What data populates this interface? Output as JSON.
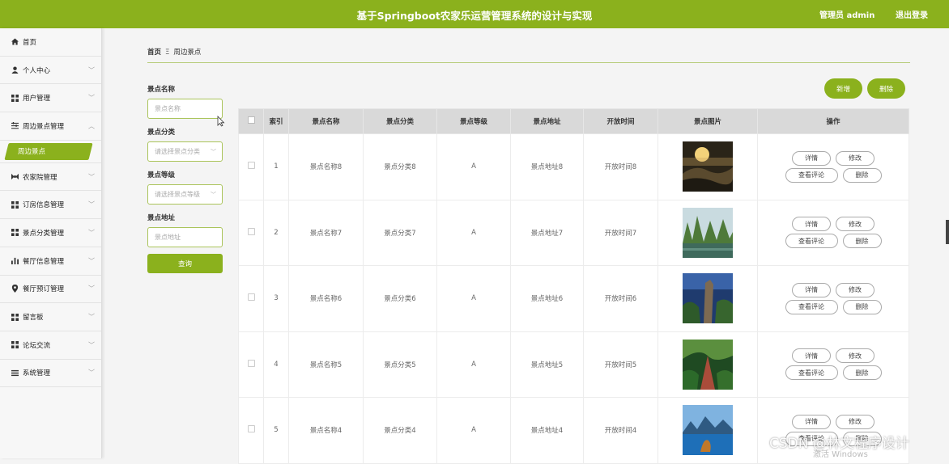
{
  "header": {
    "title": "基于Springboot农家乐运营管理系统的设计与实现",
    "admin": "管理员 admin",
    "logout": "退出登录",
    "bg_color": "#8bb11d"
  },
  "sidebar": {
    "items": [
      {
        "label": "首页",
        "icon": "home-icon"
      },
      {
        "label": "个人中心",
        "icon": "person-icon"
      },
      {
        "label": "用户管理",
        "icon": "grid-icon"
      },
      {
        "label": "周边景点管理",
        "icon": "sliders-icon",
        "expanded": true
      },
      {
        "label": "农家院管理",
        "icon": "bowtie-icon"
      },
      {
        "label": "订房信息管理",
        "icon": "grid-icon"
      },
      {
        "label": "景点分类管理",
        "icon": "grid-icon"
      },
      {
        "label": "餐厅信息管理",
        "icon": "bar-chart-icon"
      },
      {
        "label": "餐厅预订管理",
        "icon": "pin-icon"
      },
      {
        "label": "留言板",
        "icon": "grid-icon"
      },
      {
        "label": "论坛交流",
        "icon": "grid-icon"
      },
      {
        "label": "系统管理",
        "icon": "list-icon"
      }
    ],
    "active_sub": "周边景点"
  },
  "breadcrumb": {
    "home": "首页",
    "separator": "Ξ",
    "current": "周边景点"
  },
  "search": {
    "name_label": "景点名称",
    "name_placeholder": "景点名称",
    "category_label": "景点分类",
    "category_placeholder": "请选择景点分类",
    "level_label": "景点等级",
    "level_placeholder": "请选择景点等级",
    "address_label": "景点地址",
    "address_placeholder": "景点地址",
    "query_button": "查询"
  },
  "actions": {
    "add": "新增",
    "delete": "删除"
  },
  "table": {
    "headers": [
      "索引",
      "景点名称",
      "景点分类",
      "景点等级",
      "景点地址",
      "开放时间",
      "景点图片",
      "操作"
    ],
    "rows": [
      {
        "index": "1",
        "name": "景点名称8",
        "category": "景点分类8",
        "level": "A",
        "address": "景点地址8",
        "time": "开放时间8"
      },
      {
        "index": "2",
        "name": "景点名称7",
        "category": "景点分类7",
        "level": "A",
        "address": "景点地址7",
        "time": "开放时间7"
      },
      {
        "index": "3",
        "name": "景点名称6",
        "category": "景点分类6",
        "level": "A",
        "address": "景点地址6",
        "time": "开放时间6"
      },
      {
        "index": "4",
        "name": "景点名称5",
        "category": "景点分类5",
        "level": "A",
        "address": "景点地址5",
        "time": "开放时间5"
      },
      {
        "index": "5",
        "name": "景点名称4",
        "category": "景点分类4",
        "level": "A",
        "address": "景点地址4",
        "time": "开放时间4"
      }
    ],
    "ops": {
      "detail": "详情",
      "edit": "修改",
      "comments": "查看评论",
      "delete": "删除"
    }
  },
  "watermark": {
    "csdn": "CSDN @林文程序设计",
    "windows": "激活 Windows"
  }
}
